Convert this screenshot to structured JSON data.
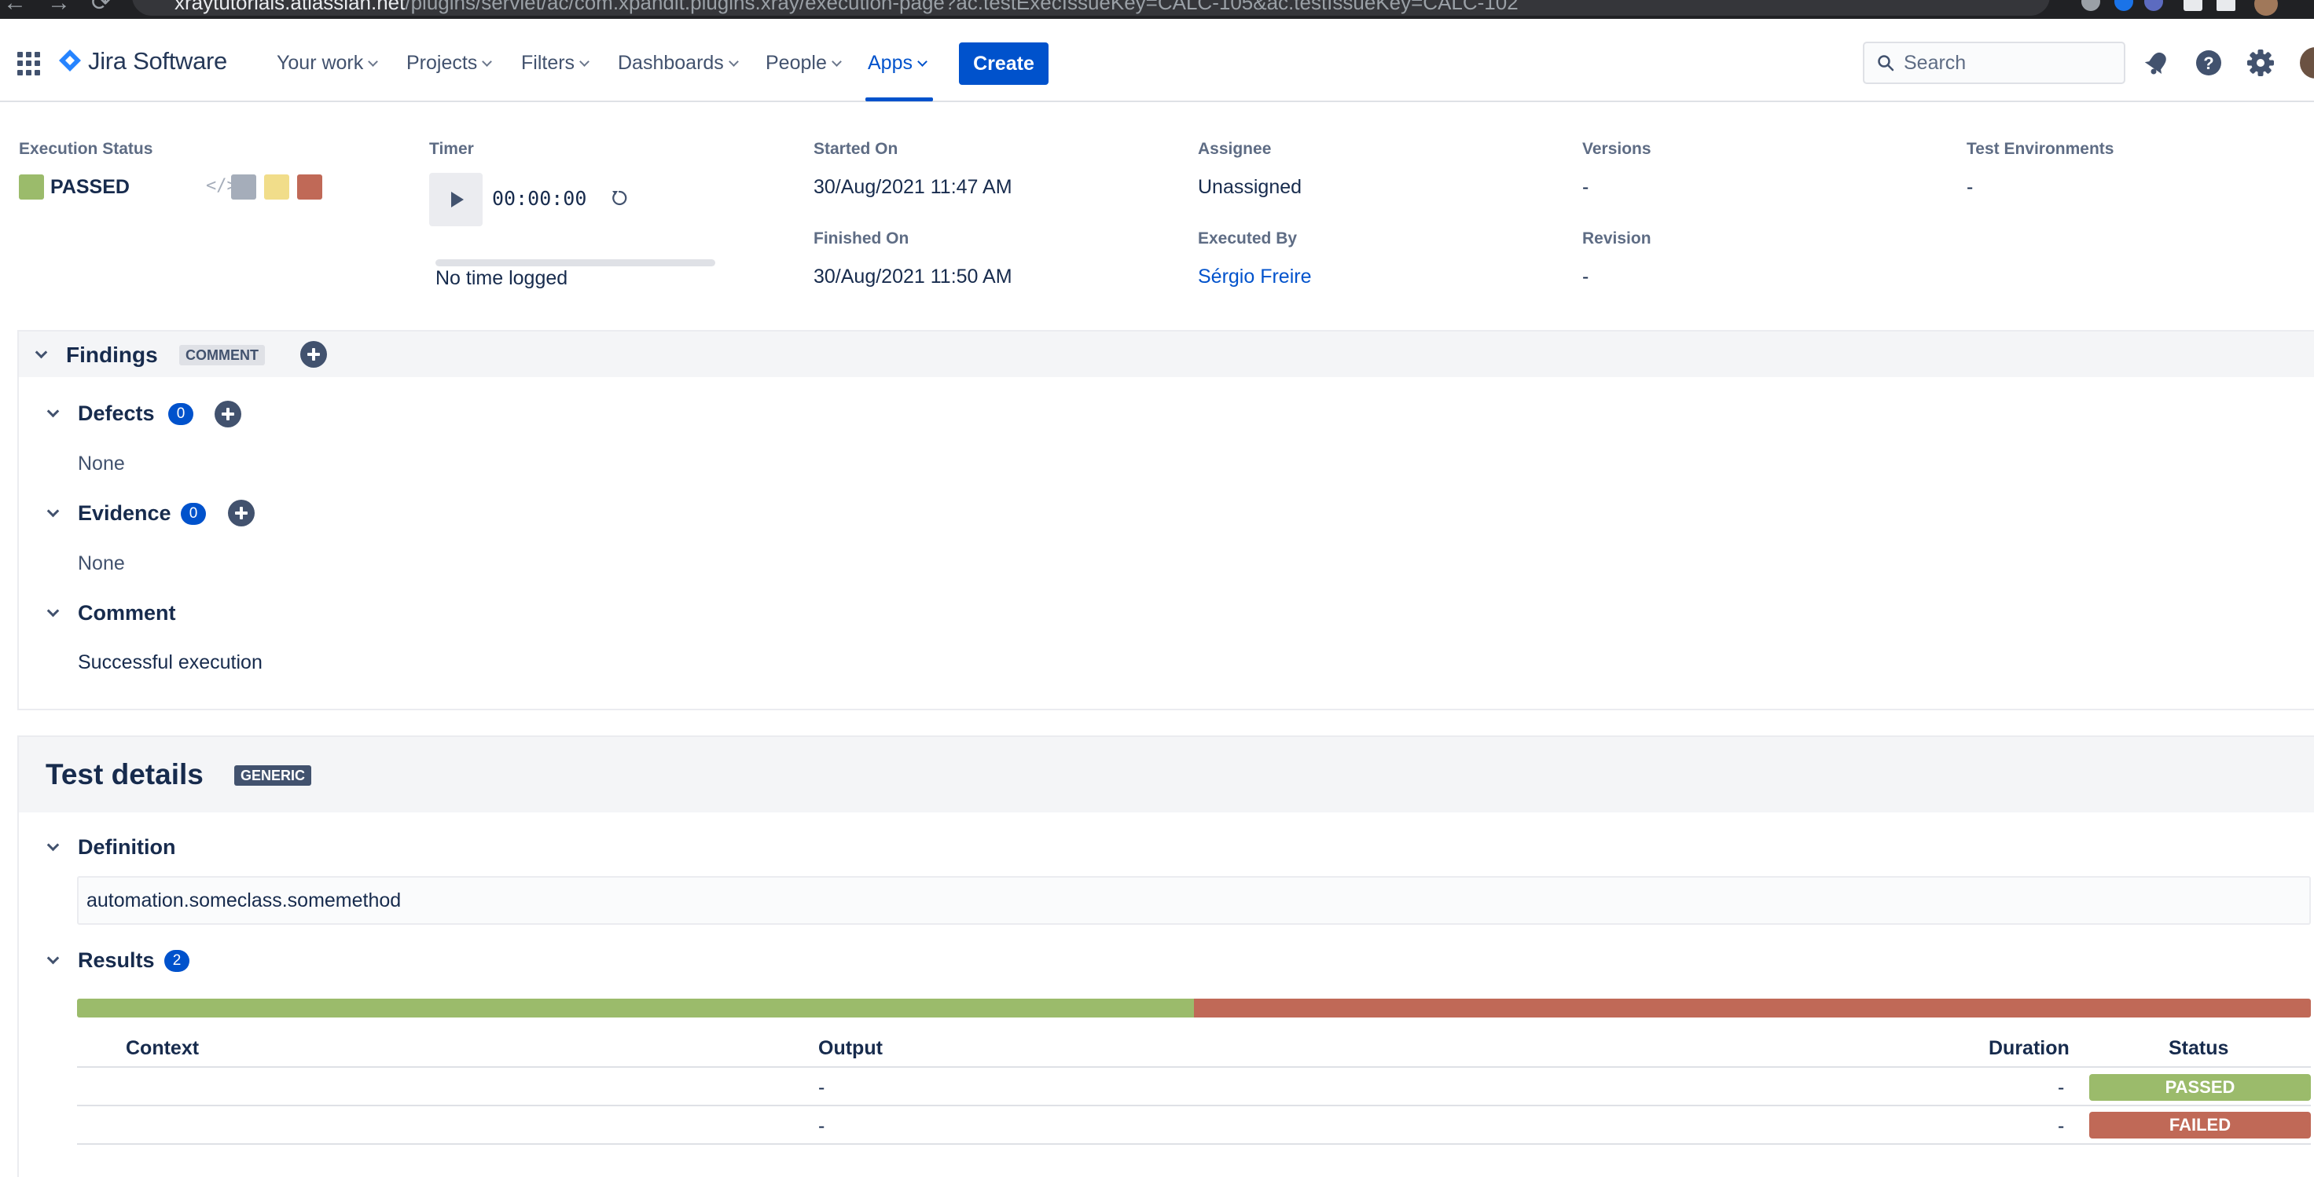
{
  "browser": {
    "url_host": "xraytutorials.atlassian.net",
    "url_path": "/plugins/servlet/ac/com.xpandit.plugins.xray/execution-page?ac.testExecIssueKey=CALC-105&ac.testIssueKey=CALC-102"
  },
  "nav": {
    "product": "Jira Software",
    "items": [
      {
        "label": "Your work"
      },
      {
        "label": "Projects"
      },
      {
        "label": "Filters"
      },
      {
        "label": "Dashboards"
      },
      {
        "label": "People"
      },
      {
        "label": "Apps"
      }
    ],
    "active_item": "Apps",
    "create_label": "Create",
    "search_placeholder": "Search",
    "icons": [
      "notifications-icon",
      "help-icon",
      "settings-icon",
      "avatar"
    ],
    "brand_color": "#0052cc"
  },
  "execution": {
    "status_label": "Execution Status",
    "status": "PASSED",
    "status_color": "#9bbb6b",
    "status_options": [
      {
        "name": "todo",
        "color": "#a5adba"
      },
      {
        "name": "executing",
        "color": "#f1dd8a"
      },
      {
        "name": "failed",
        "color": "#c06957"
      }
    ],
    "timer_label": "Timer",
    "timer_value": "00:00:00",
    "timer_note": "No time logged",
    "started_label": "Started On",
    "started_value": "30/Aug/2021 11:47 AM",
    "finished_label": "Finished On",
    "finished_value": "30/Aug/2021 11:50 AM",
    "assignee_label": "Assignee",
    "assignee_value": "Unassigned",
    "executed_by_label": "Executed By",
    "executed_by_value": "Sérgio Freire",
    "versions_label": "Versions",
    "versions_value": "-",
    "revision_label": "Revision",
    "revision_value": "-",
    "environments_label": "Test Environments",
    "environments_value": "-"
  },
  "findings": {
    "title": "Findings",
    "badge": "COMMENT",
    "defects": {
      "title": "Defects",
      "count": "0",
      "empty": "None"
    },
    "evidence": {
      "title": "Evidence",
      "count": "0",
      "empty": "None"
    },
    "comment": {
      "title": "Comment",
      "text": "Successful execution"
    }
  },
  "details": {
    "title": "Test details",
    "badge": "GENERIC",
    "definition": {
      "title": "Definition",
      "value": "automation.someclass.somemethod"
    },
    "results": {
      "title": "Results",
      "count": "2",
      "distribution": [
        {
          "status": "PASSED",
          "fraction": 0.5,
          "color": "#9bbb6b"
        },
        {
          "status": "FAILED",
          "fraction": 0.5,
          "color": "#c06957"
        }
      ],
      "columns": [
        "Context",
        "Output",
        "Duration",
        "Status"
      ],
      "rows": [
        {
          "context": "",
          "output": "-",
          "duration": "-",
          "status": "PASSED",
          "color": "#9bbb6b"
        },
        {
          "context": "",
          "output": "-",
          "duration": "-",
          "status": "FAILED",
          "color": "#c06957"
        }
      ]
    }
  }
}
